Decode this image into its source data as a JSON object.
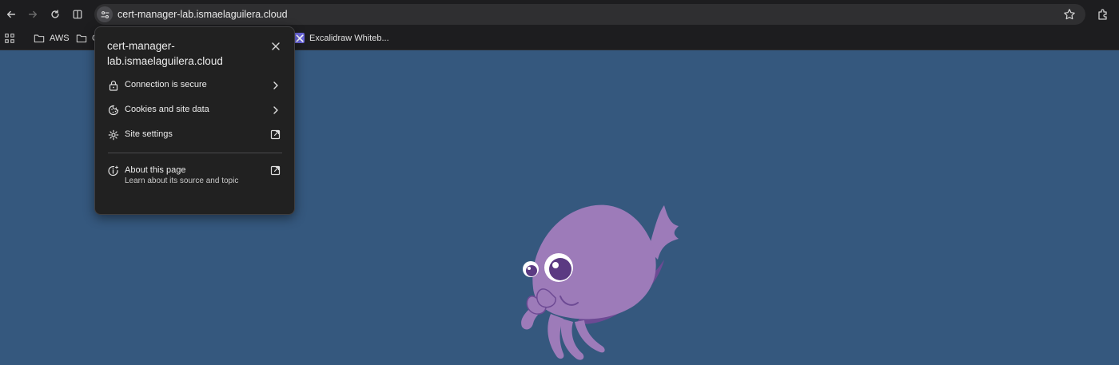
{
  "browser": {
    "url": "cert-manager-lab.ismaelaguilera.cloud"
  },
  "bookmarks": {
    "items": [
      {
        "label": "AWS"
      },
      {
        "label": "C"
      },
      {
        "label": "Excalidraw Whiteb..."
      }
    ]
  },
  "site_info_popup": {
    "title": "cert-manager-lab.ismaelaguilera.cloud",
    "items": [
      {
        "label": "Connection is secure",
        "icon": "lock-icon"
      },
      {
        "label": "Cookies and site data",
        "icon": "cookie-icon"
      },
      {
        "label": "Site settings",
        "icon": "gear-icon"
      }
    ],
    "about": {
      "label": "About this page",
      "sublabel": "Learn about its source and topic"
    }
  },
  "colors": {
    "page_background": "#35587e",
    "browser_chrome": "#1d1d1f",
    "popup_background": "#212121",
    "mascot_purple": "#9d7bb9",
    "mascot_dark": "#6d4a94"
  }
}
